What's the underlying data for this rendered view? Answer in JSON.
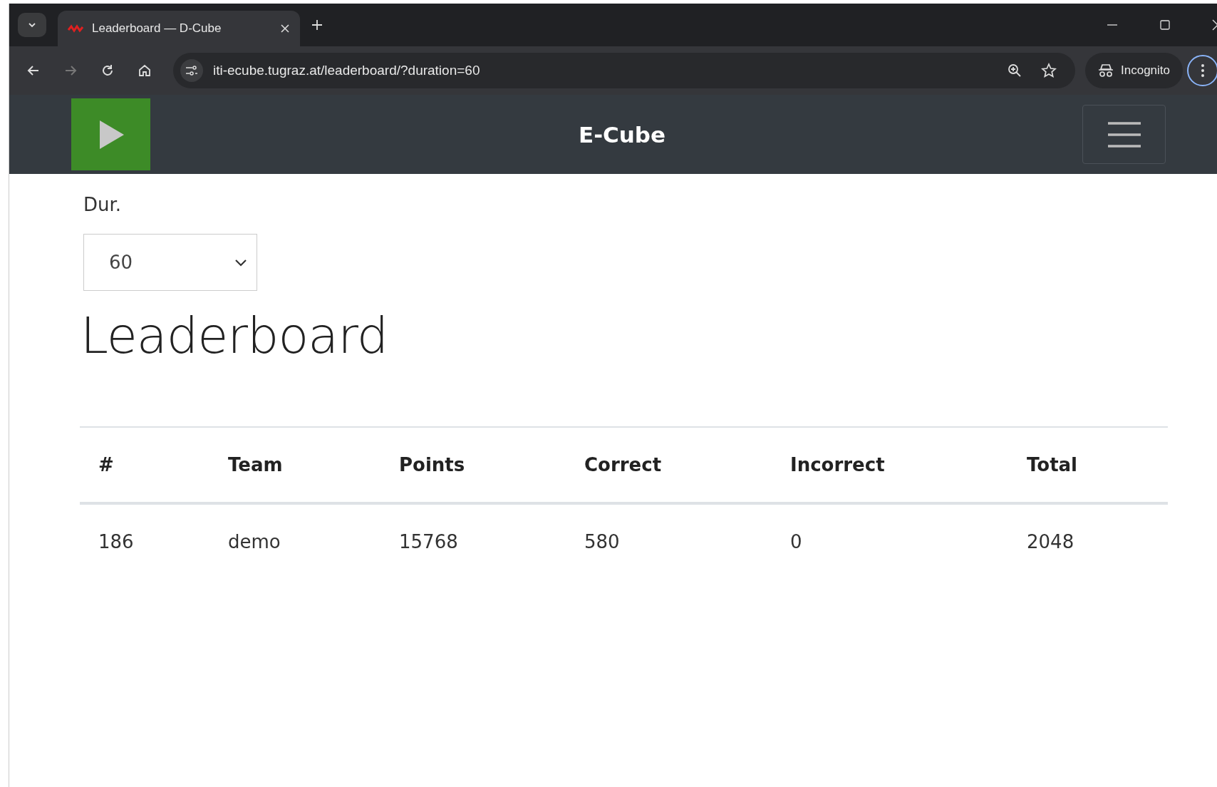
{
  "browser": {
    "tabs": [
      {
        "title": "Leaderboard — D-Cube",
        "selected": true
      }
    ],
    "url": "iti-ecube.tugraz.at/leaderboard/?duration=60",
    "profile_label": "Incognito"
  },
  "navbar": {
    "brand": "E-Cube"
  },
  "filter": {
    "label": "Dur.",
    "value": "60"
  },
  "heading": "Leaderboard",
  "table": {
    "columns": [
      "#",
      "Team",
      "Points",
      "Correct",
      "Incorrect",
      "Total"
    ],
    "rows": [
      [
        "186",
        "demo",
        "15768",
        "580",
        "0",
        "2048"
      ]
    ]
  }
}
